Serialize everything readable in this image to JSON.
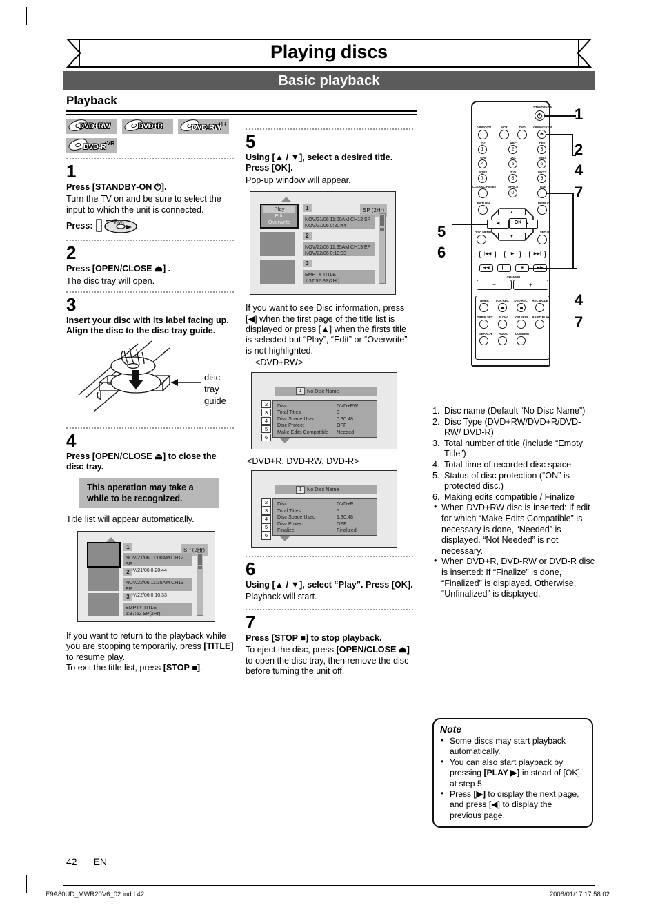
{
  "header": {
    "title": "Playing discs",
    "section": "Basic playback",
    "subsection": "Playback"
  },
  "disc_badges": [
    {
      "label": "DVD+RW",
      "vr": ""
    },
    {
      "label": "DVD+R",
      "vr": ""
    },
    {
      "label": "DVD-RW",
      "vr": "+VR"
    },
    {
      "label": "DVD-R",
      "vr": "+VR"
    }
  ],
  "steps": {
    "s1": {
      "num": "1",
      "head": "Press [STANDBY-ON ⏻].",
      "body": "Turn the TV on and be sure to select the input to which the unit is connected.",
      "press_label": "Press:",
      "press_icon_text": "DVD"
    },
    "s2": {
      "num": "2",
      "head": "Press [OPEN/CLOSE ⏏] .",
      "body": "The disc tray will open."
    },
    "s3": {
      "num": "3",
      "head": "Insert your disc with its label facing up. Align the disc to the disc tray guide.",
      "caption_l1": "disc",
      "caption_l2": "tray",
      "caption_l3": "guide"
    },
    "s4": {
      "num": "4",
      "head": "Press [OPEN/CLOSE ⏏] to close the disc tray.",
      "callout": "This operation may take a while to be recognized.",
      "body": "Title list will appear automatically."
    },
    "s5": {
      "num": "5",
      "head": "Using [▲ / ▼], select a desired title. Press [OK].",
      "body": "Pop-up window will appear.",
      "note": "If you want to see Disc information, press [◀] when the first page of the title list is displayed or press [▲] when the firsts title is selected but “Play”, “Edit” or “Overwrite” is not highlighted.",
      "label_dvdplusrw": "<DVD+RW>",
      "label_others": "<DVD+R, DVD-RW, DVD-R>"
    },
    "s6": {
      "num": "6",
      "head": "Using [▲ / ▼], select “Play”. Press [OK].",
      "body": "Playback will start."
    },
    "s7": {
      "num": "7",
      "head": "Press [STOP ■] to stop playback.",
      "body_1": "To eject the disc, press ",
      "body_bold": "[OPEN/CLOSE ⏏]",
      "body_2": " to open the disc tray, then remove the disc before turning the unit off."
    }
  },
  "resume_text": {
    "l1": "If you want to return to the playback while you are stopping temporarily, press ",
    "b1": "[TITLE]",
    "l2": " to resume play.",
    "l3": "To exit the title list, press ",
    "b2": "[STOP ■]",
    "l4": "."
  },
  "title_list": {
    "sp_tag": "SP (2Hr)",
    "rows": [
      {
        "num": "1",
        "line1": "NOV/21/06   11:00AM CH12  SP",
        "line2": "NOV/21/06     0:20:44"
      },
      {
        "num": "2",
        "line1": "NOV/22/06   11:35AM CH13  EP",
        "line2": "NOV/22/06     0:10:33"
      },
      {
        "num": "3",
        "line1": "EMPTY TITLE",
        "line2": "1:37:52   SP(2Hr)"
      }
    ],
    "popup_items": [
      "Play",
      "Edit",
      "Overwrite"
    ]
  },
  "disc_info_plusrw": {
    "disc_name": "No Disc Name",
    "name_num": "1",
    "rows": [
      {
        "num": "2",
        "label": "Disc",
        "value": "DVD+RW"
      },
      {
        "num": "3",
        "label": "Total Titles",
        "value": "3"
      },
      {
        "num": "4",
        "label": "Disc Space Used",
        "value": "0:30:48"
      },
      {
        "num": "5",
        "label": "Disc Protect",
        "value": "OFF"
      },
      {
        "num": "6",
        "label": "Make Edits Compatible",
        "value": "Needed"
      }
    ]
  },
  "disc_info_others": {
    "disc_name": "No Disc Name",
    "name_num": "1",
    "rows": [
      {
        "num": "2",
        "label": "Disc",
        "value": "DVD+R"
      },
      {
        "num": "3",
        "label": "Total Titles",
        "value": "5"
      },
      {
        "num": "4",
        "label": "Disc Space Used",
        "value": "1:30:48"
      },
      {
        "num": "5",
        "label": "Disc Protect",
        "value": "OFF"
      },
      {
        "num": "6",
        "label": "Finalize",
        "value": "Finalized"
      }
    ]
  },
  "legend": {
    "items": [
      {
        "n": "1.",
        "text": "Disc name (Default “No Disc Name”)"
      },
      {
        "n": "2.",
        "text": "Disc Type (DVD+RW/DVD+R/DVD-RW/ DVD-R)"
      },
      {
        "n": "3.",
        "text": "Total number of title (include “Empty Title”)"
      },
      {
        "n": "4.",
        "text": "Total time of recorded disc space"
      },
      {
        "n": "5.",
        "text": "Status of disc protection (“ON” is protected disc.)"
      },
      {
        "n": "6.",
        "text": "Making edits compatible / Finalize"
      }
    ],
    "bullets": [
      "When DVD+RW disc is inserted: If edit for which “Make Edits Compatible” is necessary is done, “Needed” is displayed. “Not Needed” is not necessary.",
      "When DVD+R, DVD-RW or DVD-R disc is inserted: If “Finalize” is done, “Finalized” is displayed. Otherwise, “Unfinalized” is displayed."
    ]
  },
  "note": {
    "title": "Note",
    "items": [
      {
        "pre": "Some discs may start playback automatically.",
        "bold": "",
        "post": ""
      },
      {
        "pre": "You can also start playback by pressing ",
        "bold": "[PLAY ▶]",
        "post": " in stead of [OK] at step 5."
      },
      {
        "pre": "Press ",
        "bold": "[▶]",
        "post": " to display the next page, and press [◀] to display the previous page."
      }
    ]
  },
  "remote": {
    "labels": {
      "standby": "STANDBY-ON",
      "videotv": "VIDEO/TV",
      "vcr": "VCR",
      "dvd": "DVD",
      "openclose": "OPEN/CLOSE",
      "n1_sub": ".@/:",
      "n2_sub": "ABC",
      "n3_sub": "DEF",
      "n4_sub": "GHI",
      "n5_sub": "JKL",
      "n6_sub": "MNO",
      "n7_sub": "PQRS",
      "n8_sub": "TUV",
      "n9_sub": "WXYZ",
      "clear": "CLEAR/C-RESET",
      "space": "SPACE",
      "title": "TITLE",
      "return": "RETURN",
      "display": "DISPLAY",
      "discmenu": "DISC MENU",
      "setup": "SETUP",
      "ok": "OK",
      "channel": "CHANNEL",
      "ch_minus": "−",
      "ch_plus": "+",
      "timer": "TIMER",
      "vcr_rec": "VCR REC",
      "dvd_rec": "DVD REC",
      "rec_mode": "REC MODE",
      "timer_set": "TIMER SET",
      "slow": "SLOW",
      "cm_skip": "CM SKIP",
      "rapid_play": "RAPID PLAY",
      "search": "SEARCH",
      "audio": "AUDIO",
      "dubbing": "DUBBING"
    },
    "numbers": [
      "1",
      "2",
      "3",
      "4",
      "5",
      "6",
      "7",
      "8",
      "9",
      "0"
    ],
    "callouts": {
      "c1": "1",
      "c2": "2",
      "c2b": "4",
      "c2c": "7",
      "c3": "4",
      "c3b": "7",
      "c5": "5",
      "c6": "6"
    }
  },
  "footer": {
    "page": "42",
    "lang": "EN",
    "file": "E9A80UD_MWR20V6_02.indd   42",
    "stamp": "2006/01/17   17:58:02"
  }
}
